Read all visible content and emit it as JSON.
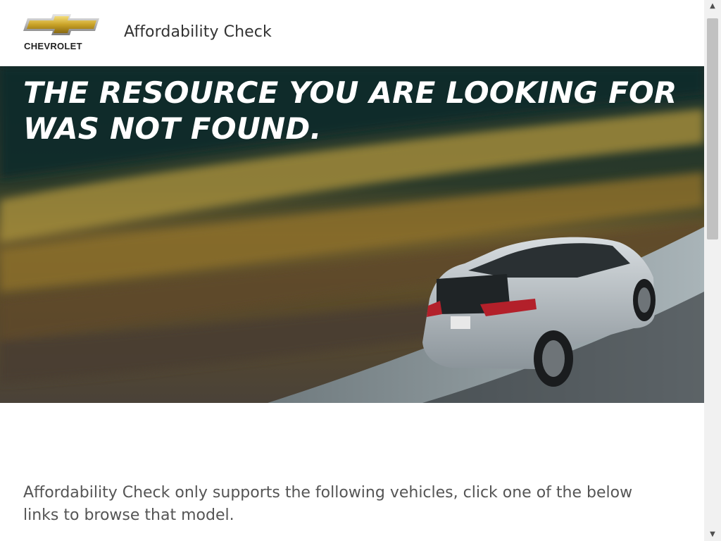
{
  "header": {
    "brand": "CHEVROLET",
    "logo_icon": "chevrolet-bowtie-icon",
    "title": "Affordability Check",
    "brand_gold": "#c9a227"
  },
  "hero": {
    "heading": "THE RESOURCE YOU ARE LOOKING FOR WAS NOT FOUND.",
    "image": "silver-hatchback-on-road-photo"
  },
  "main": {
    "message": "Affordability Check only supports the following vehicles, click one of the below links to browse that model."
  },
  "scrollbar": {
    "up_icon": "▲",
    "down_icon": "▼"
  }
}
